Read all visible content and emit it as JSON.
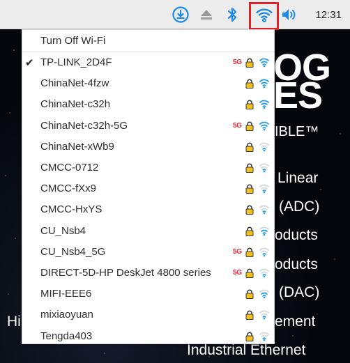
{
  "taskbar": {
    "clock": "12:31",
    "icons": [
      "download-icon",
      "eject-icon",
      "bluetooth-icon",
      "wifi-icon",
      "volume-icon"
    ],
    "accent_color": "#1e88e5",
    "highlight_color": "#e3222c"
  },
  "menu": {
    "turn_off_label": "Turn Off Wi-Fi",
    "networks": [
      {
        "ssid": "TP-LINK_2D4F",
        "connected": true,
        "band5g": "5G",
        "secured": true,
        "strength": "strong"
      },
      {
        "ssid": "ChinaNet-4fzw",
        "connected": false,
        "band5g": "",
        "secured": true,
        "strength": "strong"
      },
      {
        "ssid": "ChinaNet-c32h",
        "connected": false,
        "band5g": "",
        "secured": true,
        "strength": "strong"
      },
      {
        "ssid": "ChinaNet-c32h-5G",
        "connected": false,
        "band5g": "5G",
        "secured": true,
        "strength": "strong"
      },
      {
        "ssid": "ChinaNet-xWb9",
        "connected": false,
        "band5g": "",
        "secured": true,
        "strength": "weak"
      },
      {
        "ssid": "CMCC-0712",
        "connected": false,
        "band5g": "",
        "secured": true,
        "strength": "weak"
      },
      {
        "ssid": "CMCC-fXx9",
        "connected": false,
        "band5g": "",
        "secured": true,
        "strength": "weak"
      },
      {
        "ssid": "CMCC-HxYS",
        "connected": false,
        "band5g": "",
        "secured": true,
        "strength": "weak"
      },
      {
        "ssid": "CU_Nsb4",
        "connected": false,
        "band5g": "",
        "secured": true,
        "strength": "medium"
      },
      {
        "ssid": "CU_Nsb4_5G",
        "connected": false,
        "band5g": "5G",
        "secured": true,
        "strength": "weak"
      },
      {
        "ssid": "DIRECT-5D-HP DeskJet 4800 series",
        "connected": false,
        "band5g": "5G",
        "secured": true,
        "strength": "weak"
      },
      {
        "ssid": "MIFI-EEE6",
        "connected": false,
        "band5g": "",
        "secured": true,
        "strength": "medium"
      },
      {
        "ssid": "mixiaoyuan",
        "connected": false,
        "band5g": "",
        "secured": true,
        "strength": "weak"
      },
      {
        "ssid": "Tengda403",
        "connected": false,
        "band5g": "",
        "secured": true,
        "strength": "weak"
      }
    ],
    "check_glyph": "✔"
  },
  "desktop": {
    "big_line1": "OG",
    "big_line2": "ES",
    "line_ible": "IBLE™",
    "line_linear": "Linear",
    "line_adc": "(ADC)",
    "line_products1": "oducts",
    "line_products2": "oducts",
    "line_dac": "(DAC)",
    "line_hi": "Hi",
    "line_ement": "ement",
    "line_industrial": "Industrial Ethernet"
  }
}
